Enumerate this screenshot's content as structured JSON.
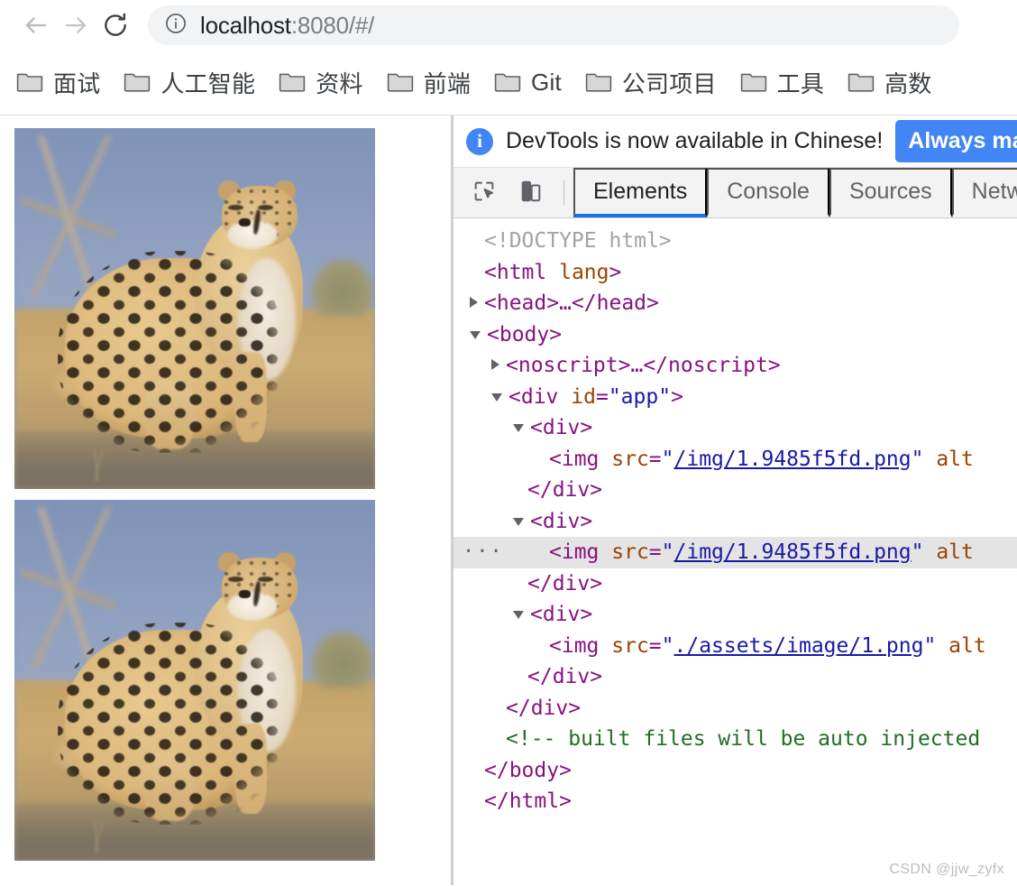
{
  "browser": {
    "nav": {
      "back_icon": "arrow-left-icon",
      "forward_icon": "arrow-right-icon",
      "reload_icon": "reload-icon"
    },
    "omnibox": {
      "site_info_icon": "info-circle-icon",
      "url_host": "localhost",
      "url_rest": ":8080/#/",
      "full_url": "localhost:8080/#/"
    },
    "bookmarks": [
      {
        "icon": "folder-icon",
        "label": "面试"
      },
      {
        "icon": "folder-icon",
        "label": "人工智能"
      },
      {
        "icon": "folder-icon",
        "label": "资料"
      },
      {
        "icon": "folder-icon",
        "label": "前端"
      },
      {
        "icon": "folder-icon",
        "label": "Git"
      },
      {
        "icon": "folder-icon",
        "label": "公司项目"
      },
      {
        "icon": "folder-icon",
        "label": "工具"
      },
      {
        "icon": "folder-icon",
        "label": "高数"
      }
    ]
  },
  "page": {
    "images": [
      {
        "name": "cheetah-photo-1",
        "alt": ""
      },
      {
        "name": "cheetah-photo-2",
        "alt": ""
      }
    ]
  },
  "devtools": {
    "banner": {
      "icon": "info-badge-icon",
      "badge_char": "i",
      "message": "DevTools is now available in Chinese!",
      "action_label": "Always match"
    },
    "toolbar": {
      "inspect_icon": "inspect-element-icon",
      "device_icon": "device-toolbar-icon"
    },
    "tabs": [
      {
        "label": "Elements",
        "active": true
      },
      {
        "label": "Console",
        "active": false
      },
      {
        "label": "Sources",
        "active": false
      },
      {
        "label": "Netw",
        "active": false
      }
    ],
    "dom_tree": [
      {
        "indent": 0,
        "twisty": "none",
        "selected": false,
        "tokens": [
          {
            "t": "doctype",
            "v": "<!DOCTYPE html>"
          }
        ]
      },
      {
        "indent": 0,
        "twisty": "none",
        "selected": false,
        "tokens": [
          {
            "t": "tag",
            "v": "<html "
          },
          {
            "t": "attr",
            "v": "lang"
          },
          {
            "t": "tag",
            "v": ">"
          }
        ]
      },
      {
        "indent": 0,
        "twisty": "closed",
        "selected": false,
        "tokens": [
          {
            "t": "tag",
            "v": "<head>…</head>"
          }
        ]
      },
      {
        "indent": 0,
        "twisty": "open",
        "selected": false,
        "tokens": [
          {
            "t": "tag",
            "v": "<body>"
          }
        ]
      },
      {
        "indent": 1,
        "twisty": "closed",
        "selected": false,
        "tokens": [
          {
            "t": "tag",
            "v": "<noscript>…</noscript>"
          }
        ]
      },
      {
        "indent": 1,
        "twisty": "open",
        "selected": false,
        "tokens": [
          {
            "t": "tag",
            "v": "<div "
          },
          {
            "t": "attr",
            "v": "id"
          },
          {
            "t": "tag",
            "v": "="
          },
          {
            "t": "val",
            "v": "\"app\""
          },
          {
            "t": "tag",
            "v": ">"
          }
        ]
      },
      {
        "indent": 2,
        "twisty": "open",
        "selected": false,
        "tokens": [
          {
            "t": "tag",
            "v": "<div>"
          }
        ]
      },
      {
        "indent": 3,
        "twisty": "none",
        "selected": false,
        "tokens": [
          {
            "t": "tag",
            "v": "<img "
          },
          {
            "t": "attr",
            "v": "src"
          },
          {
            "t": "tag",
            "v": "="
          },
          {
            "t": "val",
            "v": "\""
          },
          {
            "t": "link",
            "v": "/img/1.9485f5fd.png"
          },
          {
            "t": "val",
            "v": "\""
          },
          {
            "t": "attr",
            "v": " alt"
          }
        ]
      },
      {
        "indent": 2,
        "twisty": "none",
        "selected": false,
        "tokens": [
          {
            "t": "tag",
            "v": "</div>"
          }
        ]
      },
      {
        "indent": 2,
        "twisty": "open",
        "selected": false,
        "tokens": [
          {
            "t": "tag",
            "v": "<div>"
          }
        ]
      },
      {
        "indent": 3,
        "twisty": "none",
        "selected": true,
        "dots": "…",
        "tokens": [
          {
            "t": "tag",
            "v": "<img "
          },
          {
            "t": "attr",
            "v": "src"
          },
          {
            "t": "tag",
            "v": "="
          },
          {
            "t": "val",
            "v": "\""
          },
          {
            "t": "link",
            "v": "/img/1.9485f5fd.png"
          },
          {
            "t": "val",
            "v": "\""
          },
          {
            "t": "attr",
            "v": " alt"
          }
        ]
      },
      {
        "indent": 2,
        "twisty": "none",
        "selected": false,
        "tokens": [
          {
            "t": "tag",
            "v": "</div>"
          }
        ]
      },
      {
        "indent": 2,
        "twisty": "open",
        "selected": false,
        "tokens": [
          {
            "t": "tag",
            "v": "<div>"
          }
        ]
      },
      {
        "indent": 3,
        "twisty": "none",
        "selected": false,
        "tokens": [
          {
            "t": "tag",
            "v": "<img "
          },
          {
            "t": "attr",
            "v": "src"
          },
          {
            "t": "tag",
            "v": "="
          },
          {
            "t": "val",
            "v": "\""
          },
          {
            "t": "link",
            "v": "./assets/image/1.png"
          },
          {
            "t": "val",
            "v": "\""
          },
          {
            "t": "attr",
            "v": " alt"
          }
        ]
      },
      {
        "indent": 2,
        "twisty": "none",
        "selected": false,
        "tokens": [
          {
            "t": "tag",
            "v": "</div>"
          }
        ]
      },
      {
        "indent": 1,
        "twisty": "none",
        "selected": false,
        "tokens": [
          {
            "t": "tag",
            "v": "</div>"
          }
        ]
      },
      {
        "indent": 1,
        "twisty": "none",
        "selected": false,
        "tokens": [
          {
            "t": "comment",
            "v": "<!-- built files will be auto injected"
          }
        ]
      },
      {
        "indent": 0,
        "twisty": "none",
        "selected": false,
        "tokens": [
          {
            "t": "tag",
            "v": "</body>"
          }
        ]
      },
      {
        "indent": -1,
        "twisty": "none",
        "selected": false,
        "tokens": [
          {
            "t": "tag",
            "v": "</html>"
          }
        ]
      }
    ]
  },
  "watermark": "CSDN @jjw_zyfx",
  "colors": {
    "accent_blue": "#4285f4",
    "tab_underline": "#1a73e8",
    "omnibox_bg": "#f1f3f4",
    "tag_purple": "#881280",
    "attr_orange": "#994500",
    "value_blue": "#1a1aa6",
    "comment_green": "#236e25",
    "selected_row": "#e4e4e4"
  }
}
